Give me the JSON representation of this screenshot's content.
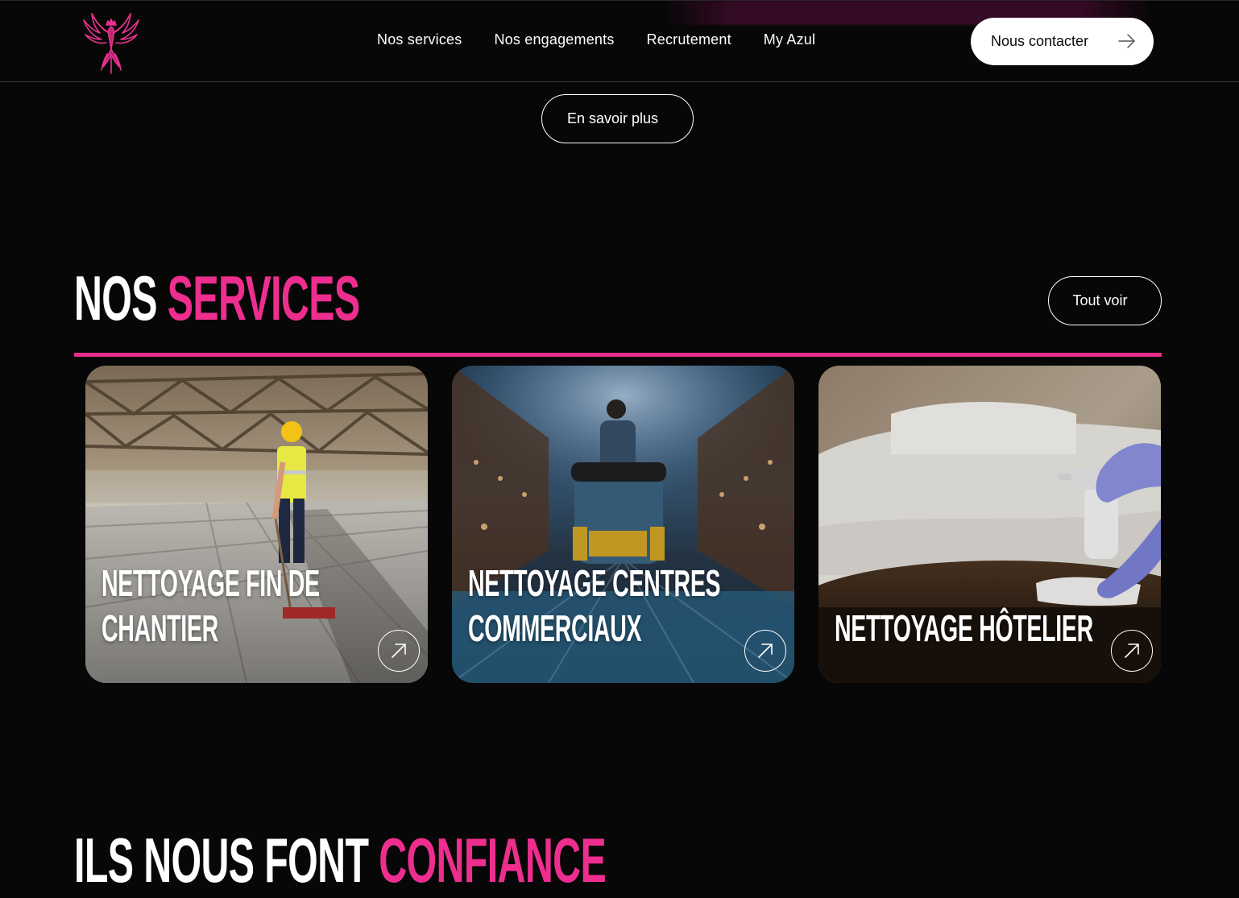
{
  "header": {
    "nav": [
      "Nos services",
      "Nos engagements",
      "Recrutement",
      "My Azul"
    ],
    "contact_label": "Nous contacter"
  },
  "hero": {
    "more_label": "En savoir plus"
  },
  "services": {
    "title_white": "NOS",
    "title_pink": "SERVICES",
    "see_all_label": "Tout voir",
    "cards": [
      {
        "title": "NETTOYAGE FIN DE CHANTIER"
      },
      {
        "title": "NETTOYAGE CENTRES COMMERCIAUX"
      },
      {
        "title": "NETTOYAGE HÔTELIER"
      }
    ]
  },
  "trust": {
    "title_white": "ILS NOUS FONT",
    "title_pink": "CONFIANCE"
  },
  "colors": {
    "background": "#070707",
    "accent_pink": "#ee2e8e",
    "text": "#ffffff"
  },
  "icons": [
    "phoenix-logo-icon",
    "arrow-right-icon",
    "arrow-up-right-icon"
  ]
}
